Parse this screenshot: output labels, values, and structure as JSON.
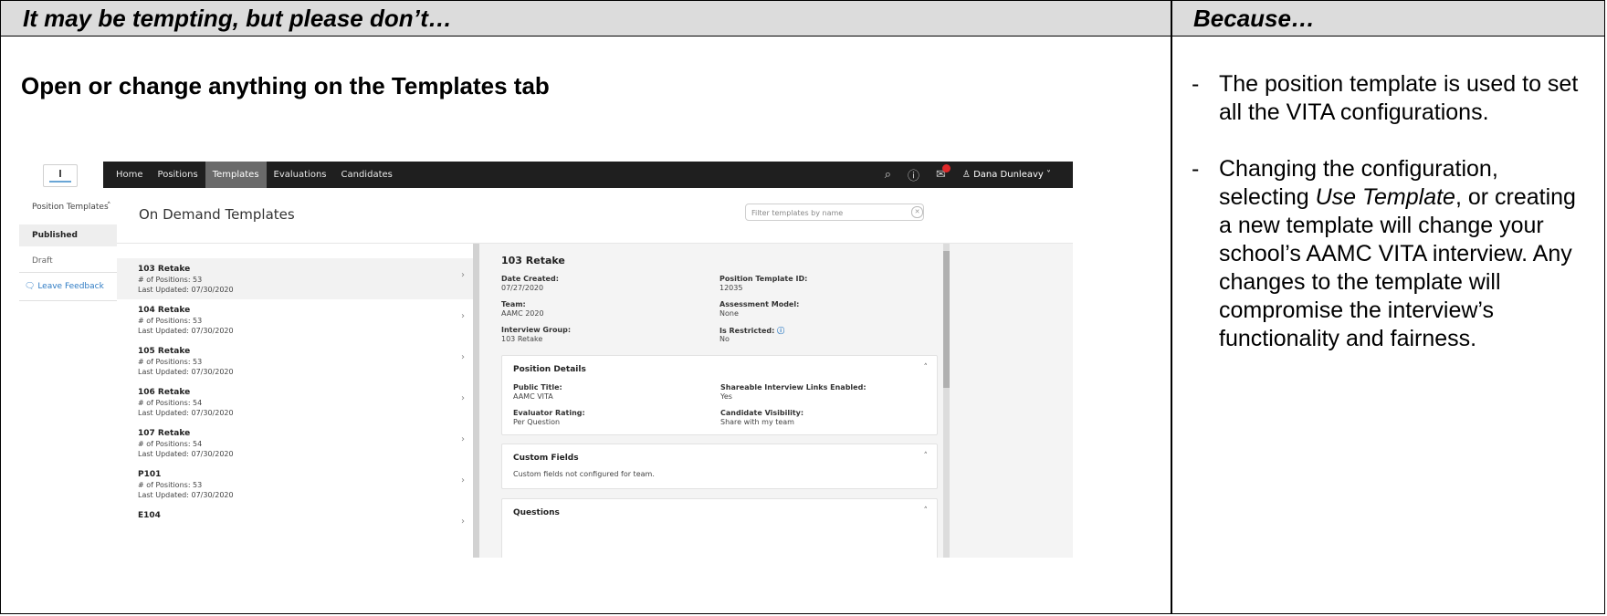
{
  "header": {
    "left": "It may be tempting, but please don’t…",
    "right": "Because…"
  },
  "rule": "Open or change anything on the Templates tab",
  "because": {
    "item1": "The position template is used to set all the VITA configurations.",
    "item2_a": "Changing the configuration, selecting ",
    "item2_em": "Use Template",
    "item2_b": ", or creating a new template will change your school’s AAMC VITA interview. Any changes to the template will compromise the interview’s functionality and fairness.",
    "dash": "-"
  },
  "screenshot": {
    "nav": [
      "Home",
      "Positions",
      "Templates",
      "Evaluations",
      "Candidates"
    ],
    "user_name": "♙ Dana Dunleavy ˅",
    "icons": {
      "search": "search-icon",
      "help": "help-icon",
      "notifications": "notification-icon"
    },
    "sidebar": {
      "header": "Position Templates",
      "published": "Published",
      "draft": "Draft",
      "feedback": "Leave Feedback"
    },
    "page_title": "On Demand Templates",
    "filter_placeholder": "Filter templates by name",
    "list": [
      {
        "title": "103 Retake",
        "positions": "# of Positions: 53",
        "updated": "Last Updated: 07/30/2020"
      },
      {
        "title": "104 Retake",
        "positions": "# of Positions: 53",
        "updated": "Last Updated: 07/30/2020"
      },
      {
        "title": "105 Retake",
        "positions": "# of Positions: 53",
        "updated": "Last Updated: 07/30/2020"
      },
      {
        "title": "106 Retake",
        "positions": "# of Positions: 54",
        "updated": "Last Updated: 07/30/2020"
      },
      {
        "title": "107 Retake",
        "positions": "# of Positions: 54",
        "updated": "Last Updated: 07/30/2020"
      },
      {
        "title": "P101",
        "positions": "# of Positions: 53",
        "updated": "Last Updated: 07/30/2020"
      },
      {
        "title": "E104",
        "positions": "",
        "updated": ""
      }
    ],
    "detail": {
      "title": "103 Retake",
      "date_created_label": "Date Created:",
      "date_created": "07/27/2020",
      "template_id_label": "Position Template ID:",
      "template_id": "12035",
      "team_label": "Team:",
      "team": "AAMC 2020",
      "assessment_label": "Assessment Model:",
      "assessment": "None",
      "group_label": "Interview Group:",
      "group": "103 Retake",
      "restricted_label": "Is Restricted:",
      "restricted": "No",
      "position_details": {
        "title": "Position Details",
        "public_title_label": "Public Title:",
        "public_title": "AAMC VITA",
        "shareable_label": "Shareable Interview Links Enabled:",
        "shareable": "Yes",
        "rating_label": "Evaluator Rating:",
        "rating": "Per Question",
        "visibility_label": "Candidate Visibility:",
        "visibility": "Share with my team"
      },
      "custom_fields": {
        "title": "Custom Fields",
        "text": "Custom fields not configured for team."
      },
      "questions": {
        "title": "Questions"
      }
    }
  }
}
